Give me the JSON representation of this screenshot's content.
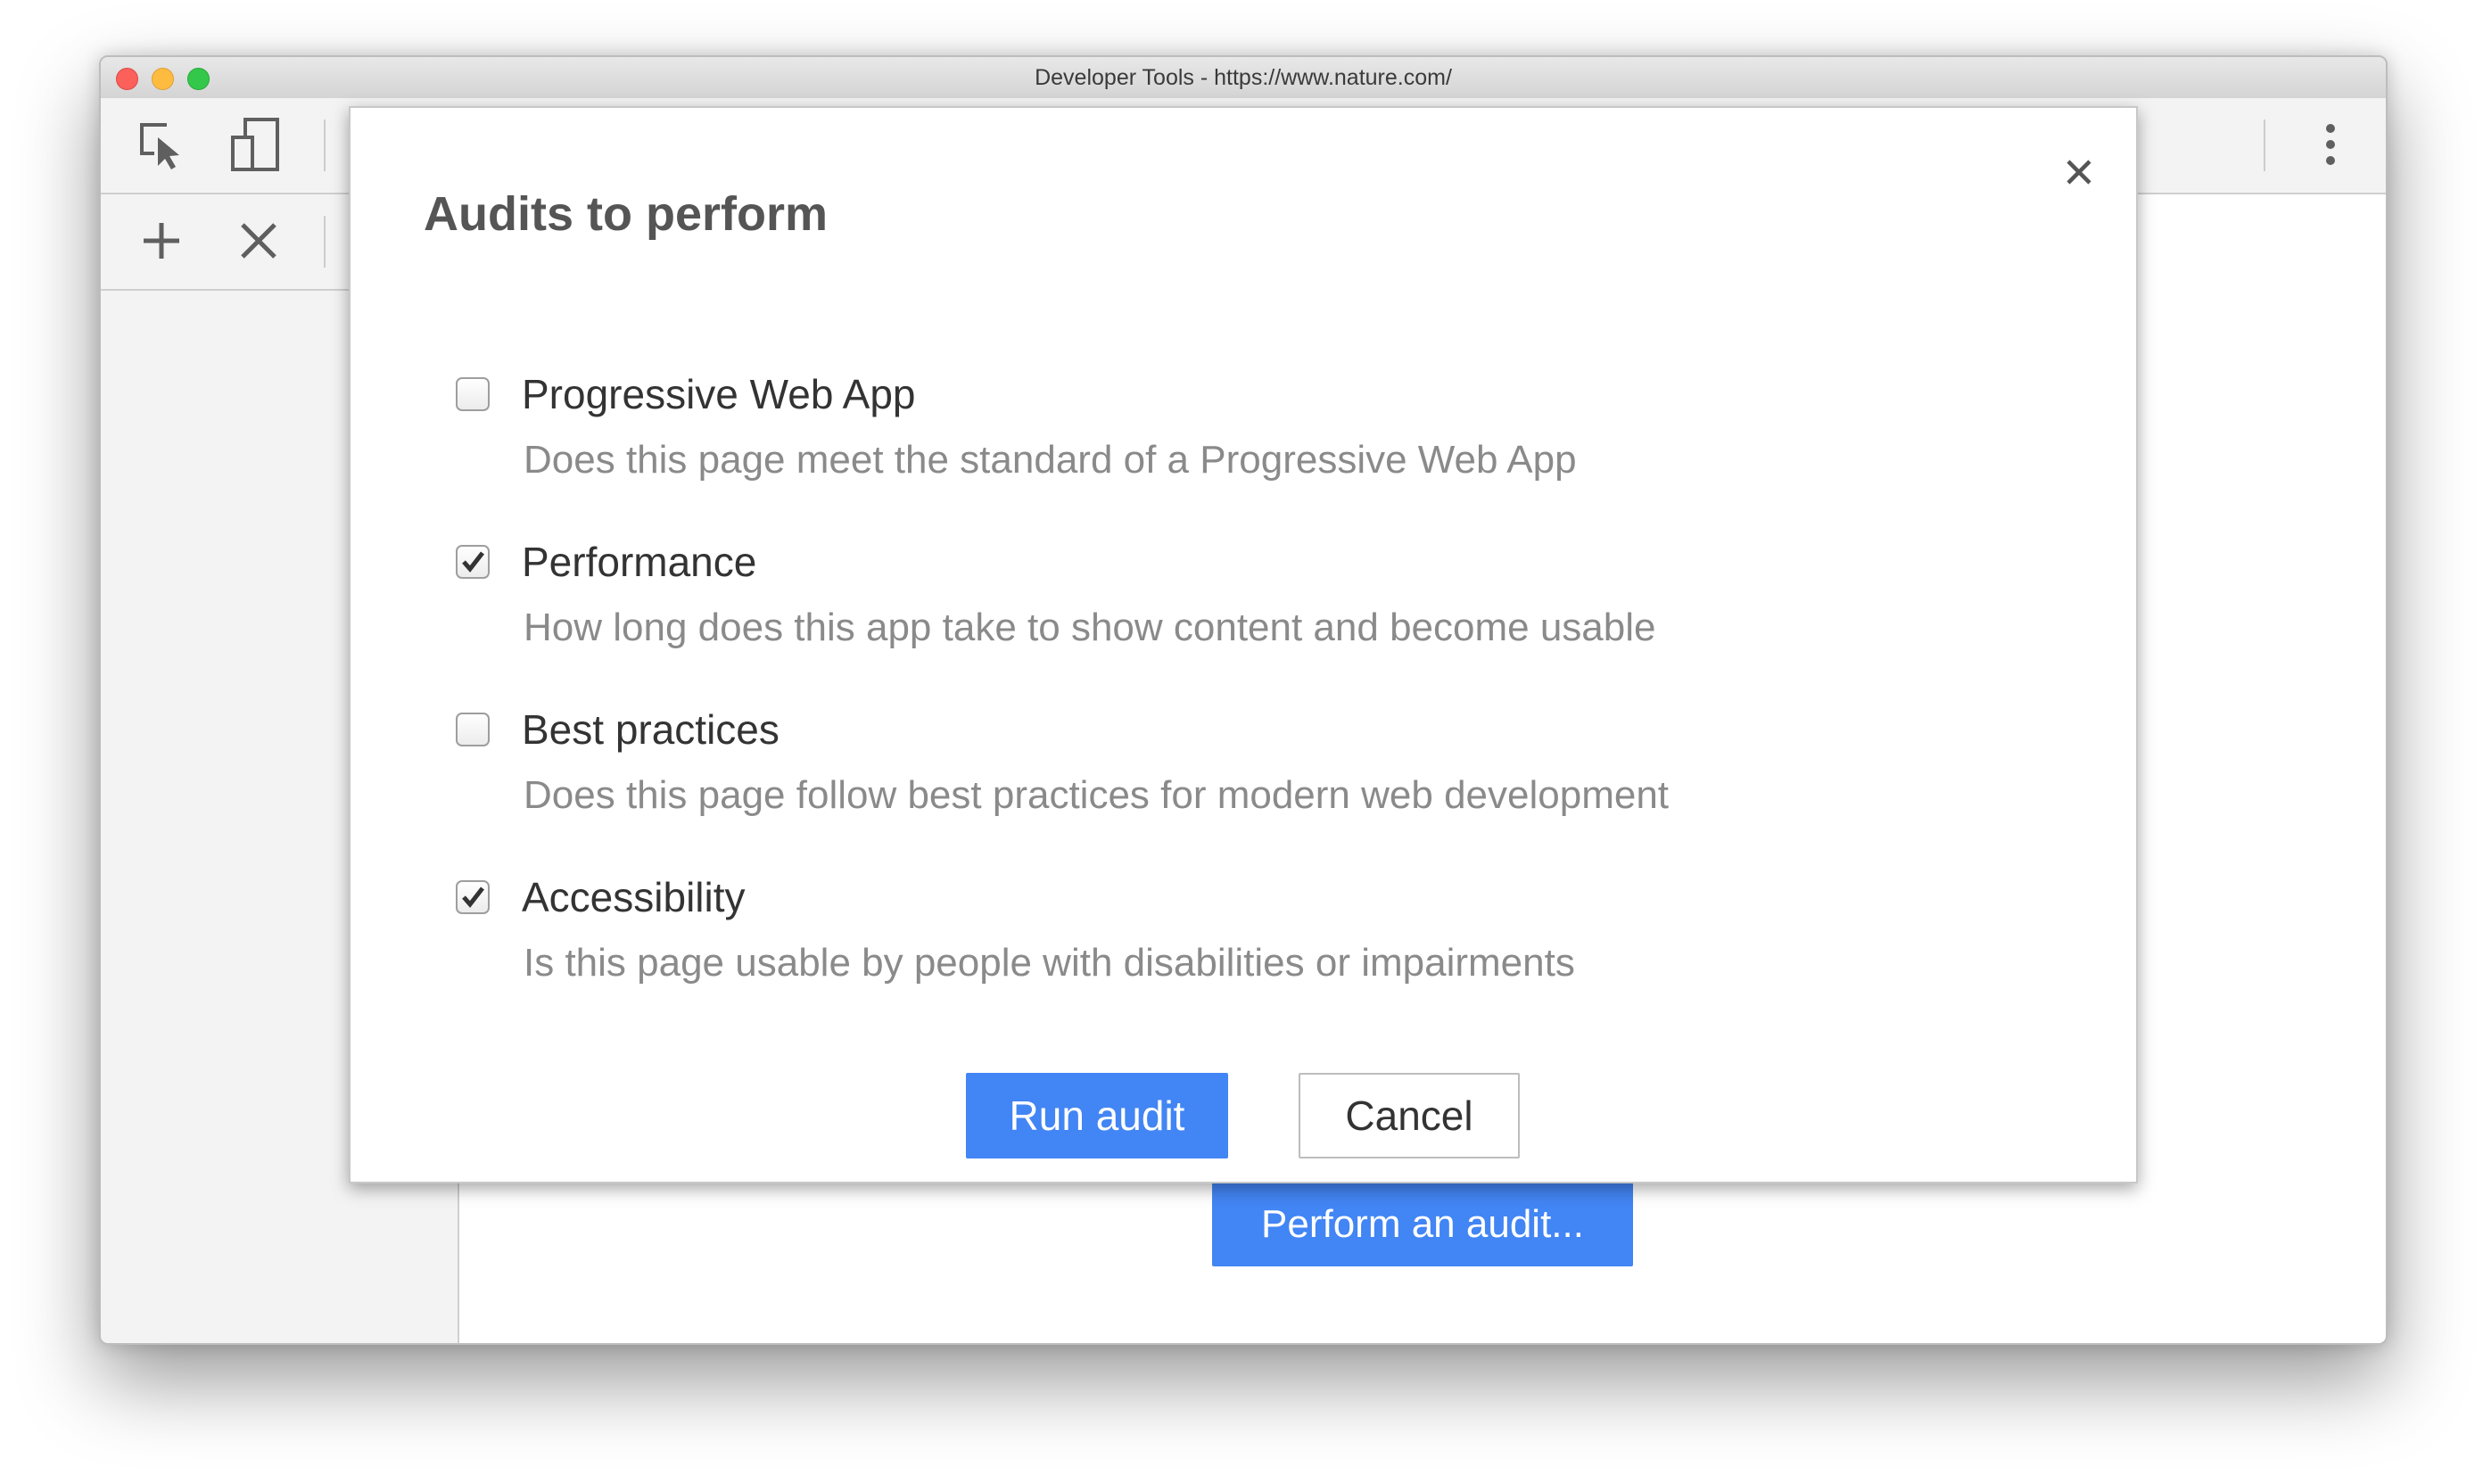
{
  "window": {
    "title": "Developer Tools - https://www.nature.com/"
  },
  "toolbar": {
    "icons": [
      "inspect-element-icon",
      "device-toolbar-icon",
      "more-options-icon",
      "add-icon",
      "clear-icon"
    ]
  },
  "page": {
    "perform_audit_label": "Perform an audit..."
  },
  "dialog": {
    "title": "Audits to perform",
    "items": [
      {
        "label": "Progressive Web App",
        "description": "Does this page meet the standard of a Progressive Web App",
        "checked": false
      },
      {
        "label": "Performance",
        "description": "How long does this app take to show content and become usable",
        "checked": true
      },
      {
        "label": "Best practices",
        "description": "Does this page follow best practices for modern web development",
        "checked": false
      },
      {
        "label": "Accessibility",
        "description": "Is this page usable by people with disabilities or impairments",
        "checked": true
      }
    ],
    "run_label": "Run audit",
    "cancel_label": "Cancel"
  },
  "colors": {
    "accent": "#4285f4",
    "close_red": "#fc605b",
    "minimize_yellow": "#fdbc40",
    "maximize_green": "#34c84a"
  }
}
